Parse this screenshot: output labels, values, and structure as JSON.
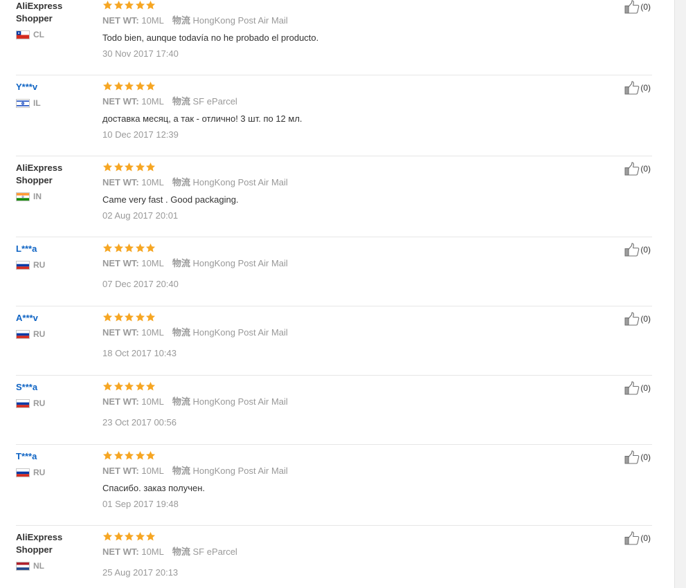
{
  "attr_labels": {
    "net_wt": "NET WT:",
    "logistics": "物流"
  },
  "accent_colors": {
    "star": "#f6a623",
    "masked_user": "#0f64c4"
  },
  "reviews": [
    {
      "user": "AliExpress Shopper",
      "masked": false,
      "country": "CL",
      "rating": 5,
      "net_wt": "10ML",
      "logistics": "HongKong Post Air Mail",
      "text": "Todo bien, aunque todavía no he probado el producto.",
      "date": "30 Nov 2017 17:40",
      "helpful": "(0)"
    },
    {
      "user": "Y***v",
      "masked": true,
      "country": "IL",
      "rating": 5,
      "net_wt": "10ML",
      "logistics": "SF eParcel",
      "text": "доставка месяц, а так - отлично! 3 шт. по 12 мл.",
      "date": "10 Dec 2017 12:39",
      "helpful": "(0)"
    },
    {
      "user": "AliExpress Shopper",
      "masked": false,
      "country": "IN",
      "rating": 5,
      "net_wt": "10ML",
      "logistics": "HongKong Post Air Mail",
      "text": "Came very fast . Good packaging.",
      "date": "02 Aug 2017 20:01",
      "helpful": "(0)"
    },
    {
      "user": "L***a",
      "masked": true,
      "country": "RU",
      "rating": 5,
      "net_wt": "10ML",
      "logistics": "HongKong Post Air Mail",
      "text": "",
      "date": "07 Dec 2017 20:40",
      "helpful": "(0)"
    },
    {
      "user": "A***v",
      "masked": true,
      "country": "RU",
      "rating": 5,
      "net_wt": "10ML",
      "logistics": "HongKong Post Air Mail",
      "text": "",
      "date": "18 Oct 2017 10:43",
      "helpful": "(0)"
    },
    {
      "user": "S***a",
      "masked": true,
      "country": "RU",
      "rating": 5,
      "net_wt": "10ML",
      "logistics": "HongKong Post Air Mail",
      "text": "",
      "date": "23 Oct 2017 00:56",
      "helpful": "(0)"
    },
    {
      "user": "T***a",
      "masked": true,
      "country": "RU",
      "rating": 5,
      "net_wt": "10ML",
      "logistics": "HongKong Post Air Mail",
      "text": "Спасибо. заказ получен.",
      "date": "01 Sep 2017 19:48",
      "helpful": "(0)"
    },
    {
      "user": "AliExpress Shopper",
      "masked": false,
      "country": "NL",
      "rating": 5,
      "net_wt": "10ML",
      "logistics": "SF eParcel",
      "text": "",
      "date": "25 Aug 2017 20:13",
      "helpful": "(0)"
    }
  ]
}
